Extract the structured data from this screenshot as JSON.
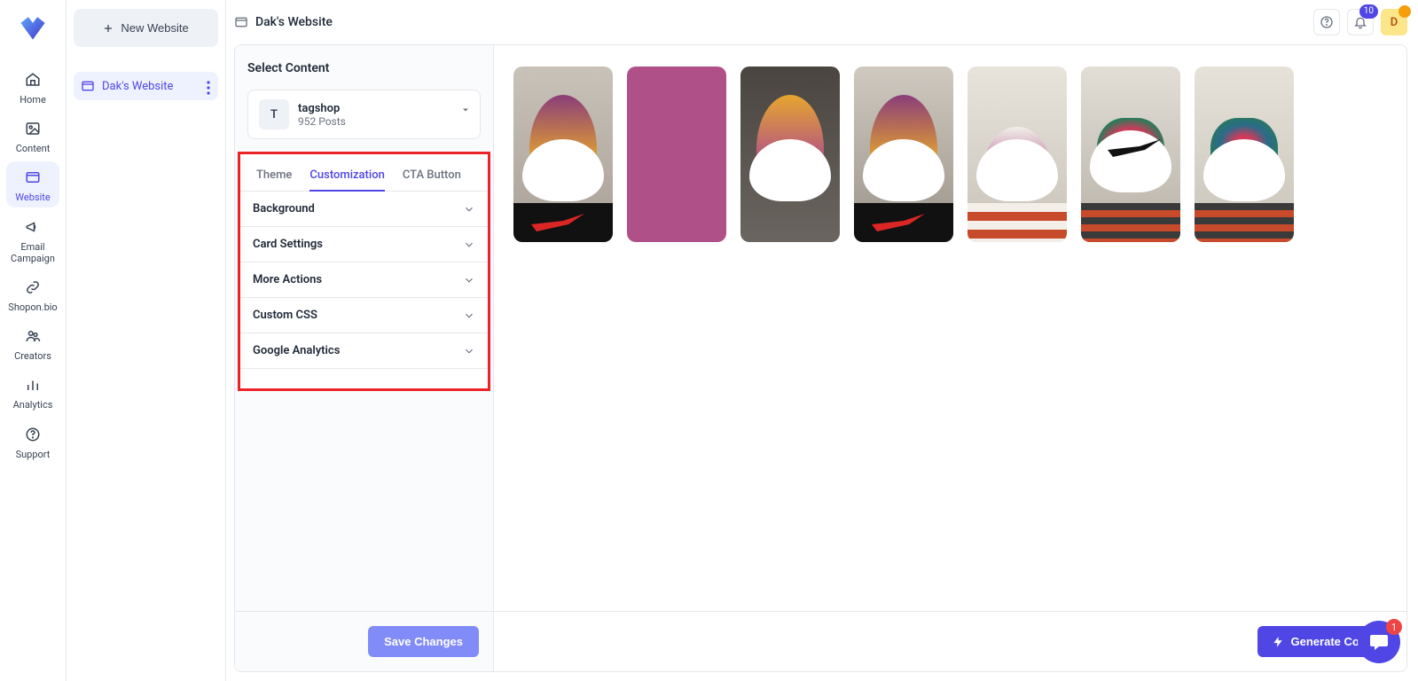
{
  "nav": {
    "items": [
      {
        "label": "Home",
        "icon": "home"
      },
      {
        "label": "Content",
        "icon": "image"
      },
      {
        "label": "Website",
        "icon": "window",
        "active": true
      },
      {
        "label": "Email Campaign",
        "icon": "megaphone"
      },
      {
        "label": "Shopon.bio",
        "icon": "link"
      },
      {
        "label": "Creators",
        "icon": "users"
      },
      {
        "label": "Analytics",
        "icon": "bars"
      },
      {
        "label": "Support",
        "icon": "help"
      }
    ]
  },
  "projects": {
    "new_label": "New Website",
    "site_label": "Dak's Website"
  },
  "topbar": {
    "title": "Dak's Website",
    "notif_count": "10",
    "user_initial": "D"
  },
  "panel": {
    "heading": "Select Content",
    "source": {
      "initial": "T",
      "name": "tagshop",
      "posts": "952 Posts"
    },
    "tabs": [
      "Theme",
      "Customization",
      "CTA Button"
    ],
    "active_tab": 1,
    "accordion": [
      "Background",
      "Card Settings",
      "More Actions",
      "Custom CSS",
      "Google Analytics"
    ],
    "save_label": "Save Changes"
  },
  "gallery": {
    "generate_label": "Generate Code"
  },
  "chat_badge": "1"
}
